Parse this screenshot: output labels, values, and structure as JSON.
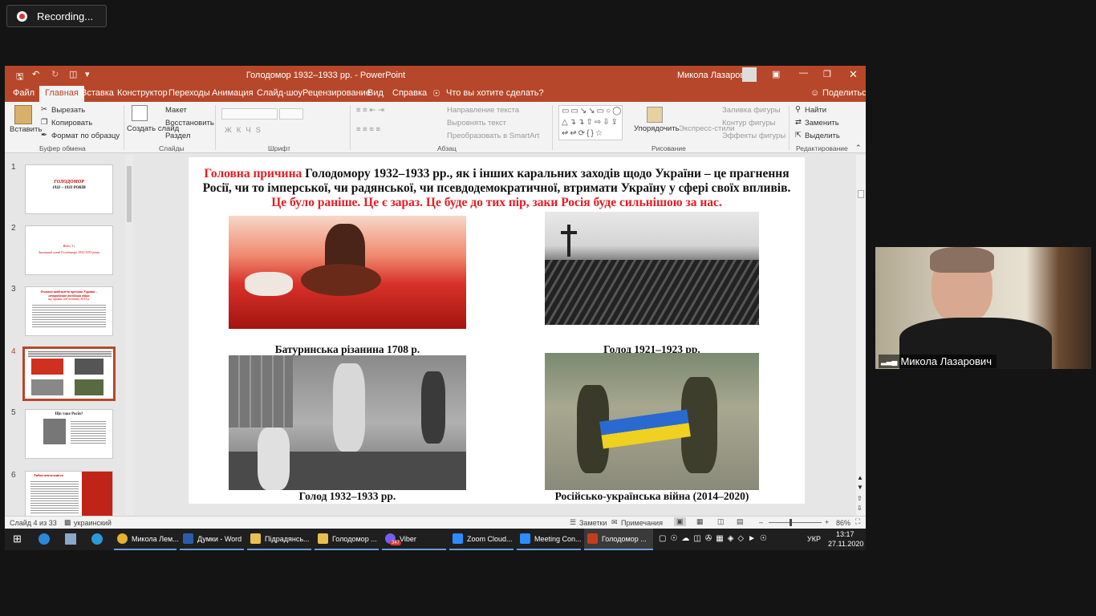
{
  "recording": {
    "label": "Recording..."
  },
  "window": {
    "title": "Голодомор 1932–1933 рр.  -  PowerPoint",
    "user": "Микола Лазарович"
  },
  "tabs": [
    "Файл",
    "Главная",
    "Вставка",
    "Конструктор",
    "Переходы",
    "Анимация",
    "Слайд-шоу",
    "Рецензирование",
    "Вид",
    "Справка"
  ],
  "tell_me": "Что вы хотите сделать?",
  "share": "Поделиться",
  "ribbon": {
    "paste": "Вставить",
    "cut": "Вырезать",
    "copy": "Копировать",
    "format_painter": "Формат по образцу",
    "clipboard": "Буфер обмена",
    "new_slide": "Создать слайд",
    "layout": "Макет",
    "reset": "Восстановить",
    "section": "Раздел",
    "slides": "Слайды",
    "font": "Шрифт",
    "text_direction": "Направление текста",
    "align_text": "Выровнять текст",
    "smartart": "Преобразовать в SmartArt",
    "paragraph": "Абзац",
    "arrange": "Упорядочить",
    "quick_styles": "Экспресс-стили",
    "shape_fill": "Заливка фигуры",
    "shape_outline": "Контур фигуры",
    "shape_effects": "Эффекты фигуры",
    "drawing": "Рисование",
    "find": "Найти",
    "replace": "Заменить",
    "select": "Выделить",
    "editing": "Редактирование"
  },
  "thumbnails": [
    {
      "num": "1",
      "title": "ГОЛОДОМОР",
      "sub": "1932 – 1933 РОКІВ"
    },
    {
      "num": "2",
      "title": "Відео 3 і",
      "sub": "Загальний огляд Голодомору 1932-1933 років"
    },
    {
      "num": "3",
      "title": "Основна найближча причина України – неукраїнсько-російська війна",
      "sub": "що триває від початку 2014 р."
    },
    {
      "num": "4"
    },
    {
      "num": "5",
      "title": "Що таке Росія?"
    },
    {
      "num": "6",
      "title": "Хибна ментальність"
    }
  ],
  "slide": {
    "title_red": "Головна причина",
    "title_black": " Голодомору 1932–1933 рр., як і інших каральних заходів щодо України – це прагнення Росії, чи то імперської, чи радянської, чи псевдодемократичної, втримати Україну у сфері своїх впливів.",
    "title_red2": "Це було раніше. Це є зараз. Це буде до тих пір, заки Росія буде сильнішою за нас.",
    "captions": [
      "Батуринська різанина 1708 р.",
      "Голод 1921–1923 рр.",
      "Голод 1932–1933 рр.",
      "Російсько-українська війна (2014–2020)"
    ]
  },
  "status": {
    "slide": "Слайд 4 из 33",
    "lang": "украинский",
    "notes": "Заметки",
    "comments": "Примечания",
    "zoom": "86%"
  },
  "taskbar": {
    "apps": [
      "Микола Лем...",
      "Думки - Word",
      "Підрадянсь...",
      "Голодомор ...",
      "Viber",
      "Zoom Cloud...",
      "Meeting Con...",
      "Голодомор ..."
    ],
    "viber_badge": "347",
    "lang": "УКР",
    "time": "13:17",
    "date": "27.11.2020"
  },
  "participant": {
    "name": "Микола Лазарович"
  },
  "colors": {
    "accent": "#b7472a",
    "red_text": "#e51c23"
  }
}
